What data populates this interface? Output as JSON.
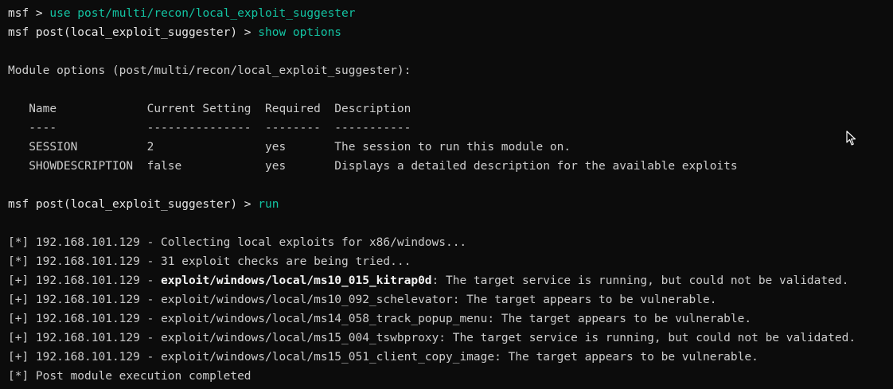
{
  "lines": [
    {
      "type": "cmd",
      "prompt": "msf > ",
      "command": "use post/multi/recon/local_exploit_suggester"
    },
    {
      "type": "cmd",
      "prompt": "msf post(local_exploit_suggester) > ",
      "command": "show options"
    },
    {
      "type": "blank"
    },
    {
      "type": "text",
      "text": "Module options (post/multi/recon/local_exploit_suggester):"
    },
    {
      "type": "blank"
    },
    {
      "type": "text",
      "text": "   Name             Current Setting  Required  Description"
    },
    {
      "type": "text",
      "text": "   ----             ---------------  --------  -----------"
    },
    {
      "type": "text",
      "text": "   SESSION          2                yes       The session to run this module on."
    },
    {
      "type": "text",
      "text": "   SHOWDESCRIPTION  false            yes       Displays a detailed description for the available exploits"
    },
    {
      "type": "blank"
    },
    {
      "type": "cmd",
      "prompt": "msf post(local_exploit_suggester) > ",
      "command": "run"
    },
    {
      "type": "blank"
    },
    {
      "type": "text",
      "text": "[*] 192.168.101.129 - Collecting local exploits for x86/windows..."
    },
    {
      "type": "text",
      "text": "[*] 192.168.101.129 - 31 exploit checks are being tried..."
    },
    {
      "type": "result",
      "prefix": "[+] 192.168.101.129 - ",
      "module": "exploit/windows/local/ms10_015_kitrap0d",
      "bold": true,
      "message": ": The target service is running, but could not be validated."
    },
    {
      "type": "result",
      "prefix": "[+] 192.168.101.129 - ",
      "module": "exploit/windows/local/ms10_092_schelevator",
      "bold": false,
      "message": ": The target appears to be vulnerable."
    },
    {
      "type": "result",
      "prefix": "[+] 192.168.101.129 - ",
      "module": "exploit/windows/local/ms14_058_track_popup_menu",
      "bold": false,
      "message": ": The target appears to be vulnerable."
    },
    {
      "type": "result",
      "prefix": "[+] 192.168.101.129 - ",
      "module": "exploit/windows/local/ms15_004_tswbproxy",
      "bold": false,
      "message": ": The target service is running, but could not be validated."
    },
    {
      "type": "result",
      "prefix": "[+] 192.168.101.129 - ",
      "module": "exploit/windows/local/ms15_051_client_copy_image",
      "bold": false,
      "message": ": The target appears to be vulnerable."
    },
    {
      "type": "text",
      "text": "[*] Post module execution completed"
    }
  ],
  "colors": {
    "background": "#0c0c0c",
    "text": "#cccccc",
    "command": "#13c4a3"
  },
  "cursor": {
    "icon": "mouse-pointer-icon"
  }
}
